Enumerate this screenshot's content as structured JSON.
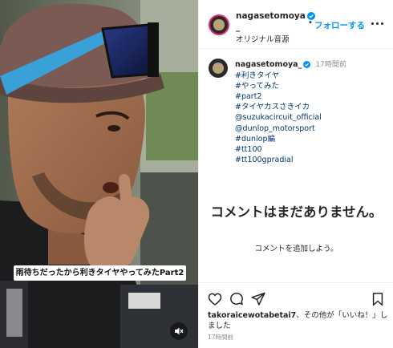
{
  "post": {
    "username": "nagasetomoya",
    "username_suffix": "_",
    "audio_label": "オリジナル音源",
    "follow_separator": "•",
    "follow_label": "フォローする",
    "more_icon": "more-horizontal-icon",
    "verified_icon": "verified-badge-icon"
  },
  "video": {
    "caption": "雨待ちだったから利きタイヤやってみたPart2",
    "mute_icon": "speaker-muted-icon"
  },
  "caption_comment": {
    "username": "nagasetomoya_",
    "time": "17時間前",
    "lines": [
      "#利きタイヤ",
      "#やってみた",
      "#part2",
      "#タイヤカスさきイカ",
      "@suzukacircuit_official",
      "@dunlop_motorsport",
      "#dunlop編",
      "#tt100",
      "#tt100gpradial"
    ]
  },
  "comments_empty": {
    "title": "コメントはまだありません。",
    "subtitle": "コメントを追加しよう。"
  },
  "actions": {
    "like_icon": "heart-icon",
    "comment_icon": "comment-icon",
    "share_icon": "paper-plane-icon",
    "save_icon": "bookmark-icon"
  },
  "likes": {
    "user": "takoraicewotabetai7",
    "text": "、その他が「いいね！」しました"
  },
  "posted_ago": "17時間前",
  "colors": {
    "link_blue": "#0095f6",
    "hashtag_blue": "#00376b",
    "verified_blue": "#0095f6",
    "muted_text": "#8e8e8e"
  }
}
